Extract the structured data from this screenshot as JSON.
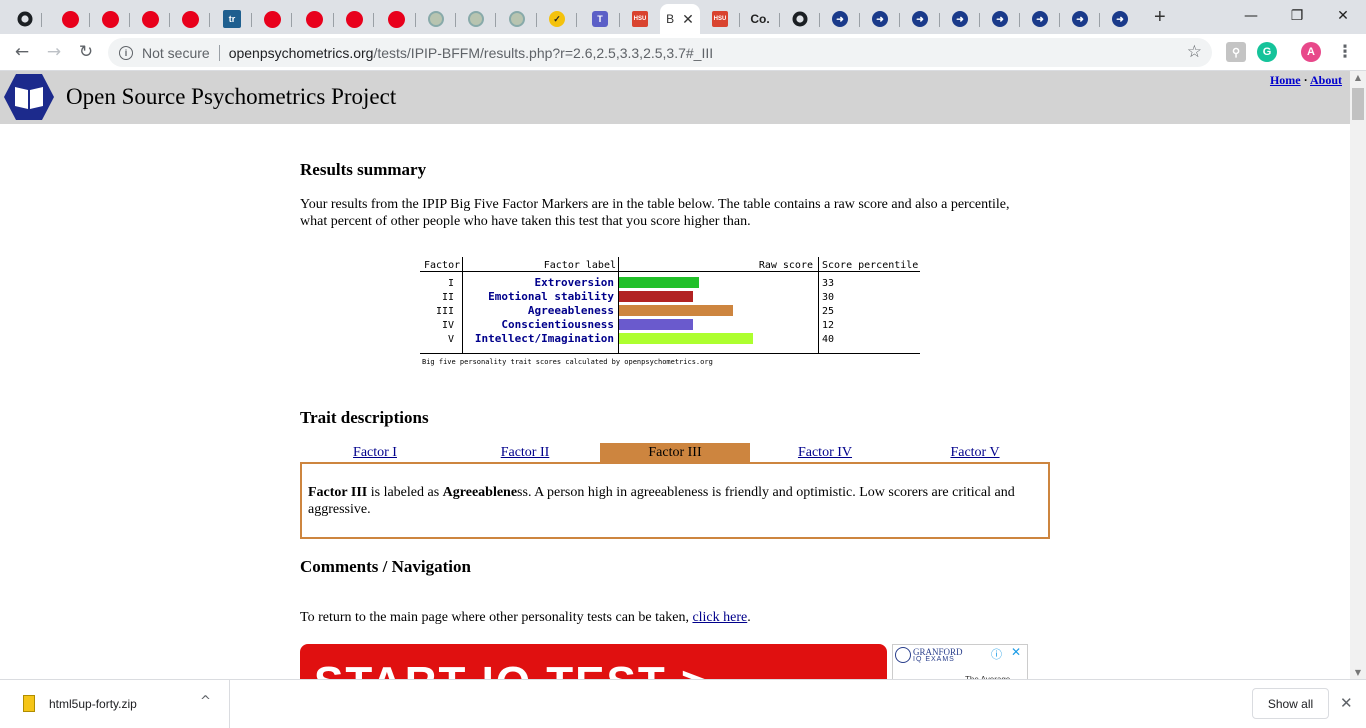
{
  "browser": {
    "active_tab": {
      "title": "B",
      "close_glyph": "✕"
    },
    "new_tab_glyph": "+",
    "window_buttons": [
      "—",
      "❐",
      "✕"
    ],
    "inactive_tab_letters": [
      "tr",
      "HSU",
      "HSU",
      "Co."
    ],
    "address": {
      "security_label": "Not secure",
      "url_host": "openpsychometrics.org",
      "url_path": "/tests/IPIP-BFFM/results.php?r=2.6,2.5,3.3,2.5,3.7#_III"
    },
    "profile_initial": "A",
    "extension_letter": "G"
  },
  "site": {
    "title": "Open Source Psychometrics Project",
    "home_link": "Home",
    "about_link": "About",
    "link_separator": "·"
  },
  "results": {
    "heading": "Results summary",
    "intro": "Your results from the IPIP Big Five Factor Markers are in the table below. The table contains a raw score and also a percentile, what percent of other people who have taken this test that you score higher than.",
    "table_headers": {
      "factor": "Factor",
      "label": "Factor label",
      "raw": "Raw score",
      "percentile": "Score percentile"
    },
    "factors": [
      {
        "factor": "I",
        "label": "Extroversion",
        "raw_fraction": 0.4,
        "percentile": "33",
        "color": "#22c02a"
      },
      {
        "factor": "II",
        "label": "Emotional stability",
        "raw_fraction": 0.37,
        "percentile": "30",
        "color": "#b22222"
      },
      {
        "factor": "III",
        "label": "Agreeableness",
        "raw_fraction": 0.57,
        "percentile": "25",
        "color": "#cd853f"
      },
      {
        "factor": "IV",
        "label": "Conscientiousness",
        "raw_fraction": 0.37,
        "percentile": "12",
        "color": "#6a5acd"
      },
      {
        "factor": "V",
        "label": "Intellect/Imagination",
        "raw_fraction": 0.67,
        "percentile": "40",
        "color": "#adff2f"
      }
    ],
    "footnote": "Big five personality trait scores calculated by openpsychometrics.org"
  },
  "traits": {
    "heading": "Trait descriptions",
    "tabs": [
      "Factor I",
      "Factor II",
      "Factor III",
      "Factor IV",
      "Factor V"
    ],
    "selected_tab": 2,
    "selected_color": "#cd853f",
    "desc_factor": "Factor III",
    "desc_mid": " is labeled as ",
    "desc_label": "Agreeablene",
    "desc_label_tail": "ss",
    "desc_rest": ". A person high in agreeableness is friendly and optimistic. Low scorers are critical and aggressive."
  },
  "comments": {
    "heading": "Comments / Navigation",
    "text": "To return to the main page where other personality tests can be taken, ",
    "link": "click here",
    "trailing": "."
  },
  "ad": {
    "banner_text": "START IQ TEST >",
    "side_brand": "GRANFORD",
    "side_sub": "IQ EXAMS",
    "side_caption": "The Average"
  },
  "downloads": {
    "file_name": "html5up-forty.zip",
    "show_all": "Show all",
    "close_glyph": "✕",
    "chevron": "^"
  }
}
